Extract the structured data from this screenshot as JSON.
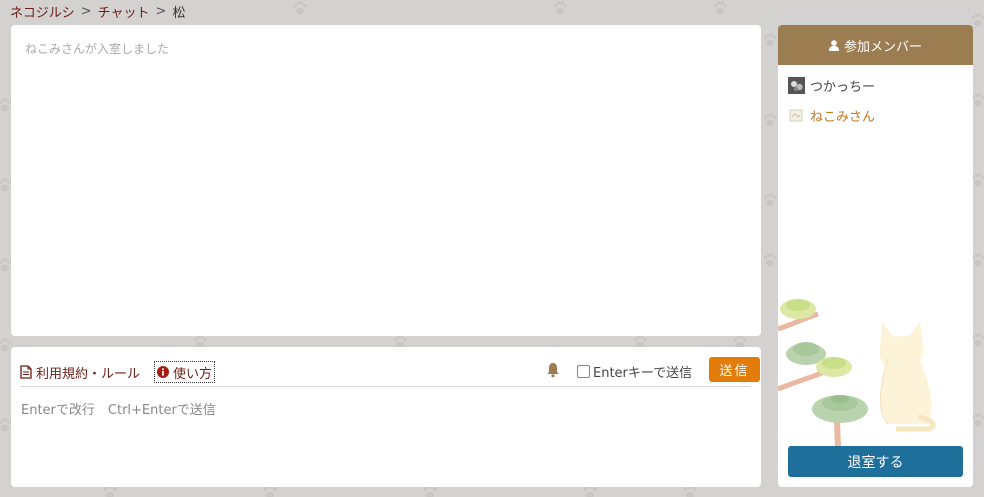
{
  "breadcrumb": {
    "home": "ネコジルシ",
    "section": "チャット",
    "current": "松",
    "separator": ">"
  },
  "chat_log": {
    "lines": [
      "ねこみさんが入室しました"
    ]
  },
  "input_area": {
    "rules_label": "利用規約・ルール",
    "help_label": "使い方",
    "enter_send_label": "Enterキーで送信",
    "enter_send_checked": false,
    "send_label": "送信",
    "placeholder": "Enterで改行　Ctrl+Enterで送信"
  },
  "members": {
    "header": "参加メンバー",
    "list": [
      {
        "name": "つかっちー",
        "color": "#444444"
      },
      {
        "name": "ねこみさん",
        "color": "#c47a25"
      }
    ],
    "leave_label": "退室する"
  },
  "colors": {
    "background": "#d4d2d0",
    "link": "#6b1d16",
    "send": "#e27c0a",
    "member_header": "#9c7d51",
    "leave": "#1f6f9b"
  },
  "icons": [
    "document-icon",
    "info-icon",
    "bell-icon",
    "user-icon"
  ]
}
